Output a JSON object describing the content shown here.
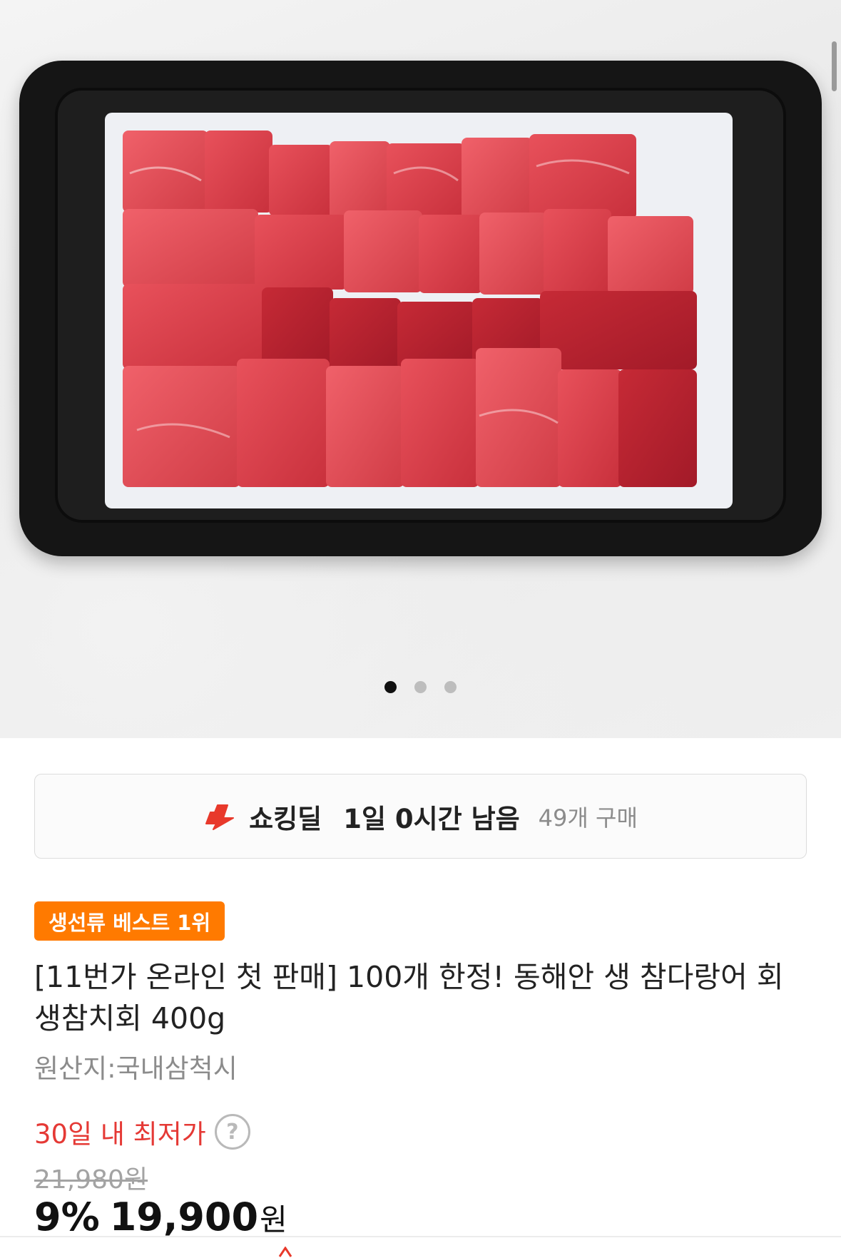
{
  "gallery": {
    "image_alt": "",
    "dot_count": 3,
    "active_index": 0
  },
  "deal": {
    "icon": "lightning-icon",
    "title": "쇼킹딜",
    "time_left": "1일 0시간 남음",
    "purchases": "49개 구매"
  },
  "badge": "생선류 베스트 1위",
  "product": {
    "title": "[11번가 온라인 첫 판매] 100개 한정! 동해안 생 참다랑어 회 생참치회 400g",
    "origin": "원산지:국내삼척시"
  },
  "price": {
    "lowest_label": "30일 내 최저가",
    "help_icon": "?",
    "original": "21,980원",
    "discount": "9%",
    "final": "19,900",
    "currency": "원"
  },
  "colors": {
    "accent_orange": "#ff7a00",
    "lowest_red": "#e53935",
    "bolt_red": "#e8392b"
  }
}
